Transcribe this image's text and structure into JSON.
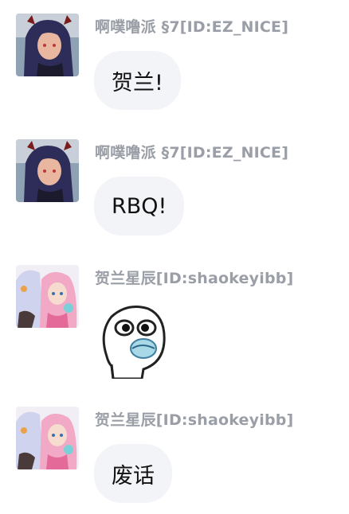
{
  "messages": [
    {
      "sender": "啊噗噜派 §7[ID:EZ_NICE]",
      "text": "贺兰!",
      "avatar": "dark-hair-anime-avatar"
    },
    {
      "sender": "啊噗噜派 §7[ID:EZ_NICE]",
      "text": "RBQ!",
      "avatar": "dark-hair-anime-avatar"
    },
    {
      "sender": "贺兰星辰[ID:shaokeyibb]",
      "sticker": "crying-meme-face-sticker",
      "avatar": "pink-hair-anime-avatar"
    },
    {
      "sender": "贺兰星辰[ID:shaokeyibb]",
      "text": "废话",
      "avatar": "pink-hair-anime-avatar"
    }
  ],
  "colors": {
    "bubble_bg": "#f3f4f7",
    "sender_name": "#9a9ea6",
    "message_text": "#111111"
  }
}
